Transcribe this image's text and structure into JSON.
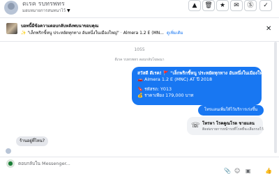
{
  "header": {
    "name": "ดเรค รบทรพทร",
    "subtitle": "มอบหมายการสนทนาไว้",
    "buttons": [
      {
        "icon": "warning-icon",
        "glyph": "▲"
      },
      {
        "icon": "trash-icon",
        "glyph": "🗑"
      },
      {
        "icon": "star-icon",
        "glyph": "★"
      },
      {
        "icon": "mark-unread-icon",
        "glyph": "✉"
      },
      {
        "icon": "spam-icon",
        "glyph": "Ⓢ"
      },
      {
        "icon": "check-icon",
        "glyph": "✓"
      }
    ]
  },
  "notice": {
    "title": "บอทนี้มีข้อความตอบกลับหลังพบนาขอบคุณ",
    "icon": "✨",
    "preview": "\"เล็กพริกขี้หนู ประหยัดทุกทาง อันหนึ่งในเมืองใหญ่\"",
    "meta": "Almera 1.2 E (MN...",
    "link": "ดูเพิ่มเติม"
  },
  "chat": {
    "time": "1055",
    "system_text": "ดีเรค รบทรพทร ตอบกลับโฆษณา",
    "message_lines": [
      "สวัสดี ดีเรค! 🚩 \"เล็กพริกขี้หนู ประหยัดทุกทาง อันหนึ่งในเมืองใหญ่\"",
      "🚗 Almera 1.2 E (MNC) AT ปี 2018",
      "🔖 รหัสรถ: Y013",
      "💰 ราคาเพียง 179,000 บาท"
    ],
    "reply_button": "โทรแลนเพิ่มให้ไว้บริการเร่งขึ้น",
    "card": {
      "icon": "phone-icon",
      "title": "โทรหา โรคคูณโรต ชายแลน",
      "subtitle": "ติดต่อรายการหน้ารถที่โรคที่จะเลือกรถไว้"
    },
    "incoming": "ร้านอยู่ที่ไหน?"
  },
  "composer": {
    "placeholder": "ตอบกลับใน Messenger...",
    "tools": [
      {
        "icon": "attach-icon",
        "glyph": "📎"
      },
      {
        "icon": "emoji-icon",
        "glyph": "☺"
      },
      {
        "icon": "gif-icon",
        "glyph": "▣"
      },
      {
        "icon": "like-icon",
        "glyph": "👍"
      }
    ]
  },
  "colors": {
    "accent": "#1877f2",
    "bubble_gray": "#e4e6eb",
    "muted_text": "#65676b"
  }
}
